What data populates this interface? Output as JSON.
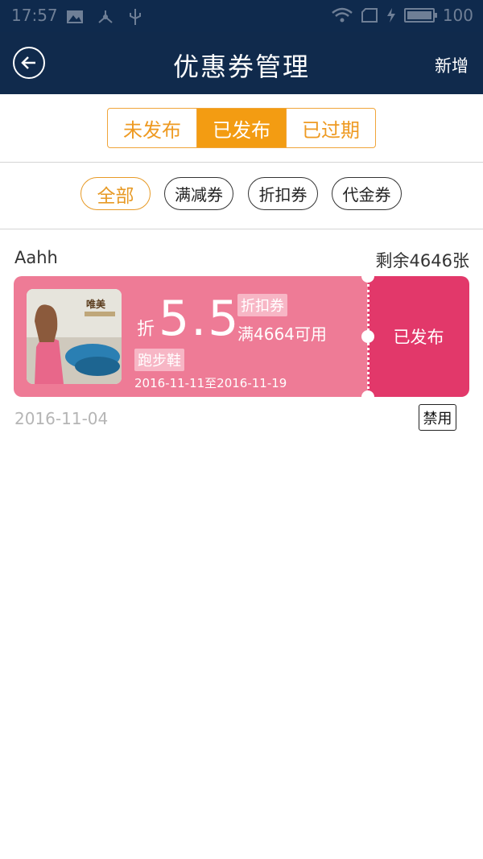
{
  "status_bar": {
    "time": "17:57",
    "battery": "100"
  },
  "nav": {
    "title": "优惠券管理",
    "action": "新增"
  },
  "publish_tabs": [
    "未发布",
    "已发布",
    "已过期"
  ],
  "type_filters": [
    "全部",
    "满减券",
    "折扣券",
    "代金券"
  ],
  "coupon": {
    "name": "Aahh",
    "remaining": "剩余4646张",
    "discount_prefix": "折",
    "discount_value": "5.5",
    "type_tag": "折扣券",
    "condition": "满4664可用",
    "category_tag": "跑步鞋",
    "valid_dates": "2016-11-11至2016-11-19",
    "status": "已发布",
    "created_date": "2016-11-04",
    "disable_label": "禁用",
    "thumb_brand_text": "唯美"
  },
  "colors": {
    "nav_bg": "#102a4c",
    "accent": "#f39c12",
    "coupon_left": "#ee7b96",
    "coupon_right": "#e2386a"
  }
}
